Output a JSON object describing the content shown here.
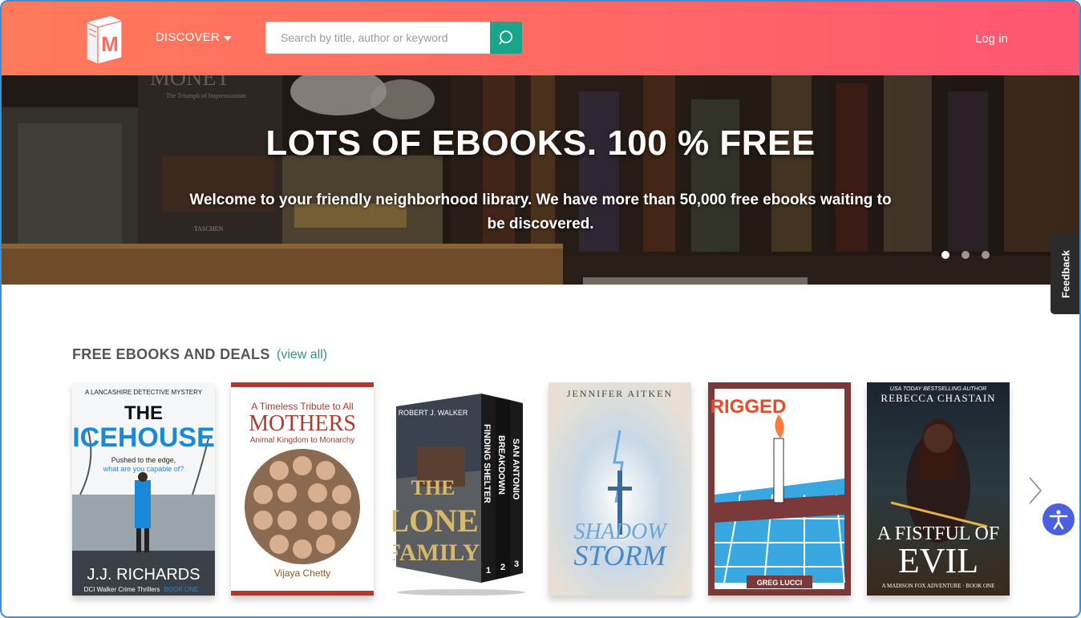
{
  "header": {
    "logo_letter": "M",
    "discover_label": "DISCOVER",
    "search_placeholder": "Search by title, author or keyword",
    "login_label": "Log in"
  },
  "hero": {
    "title": "LOTS OF EBOOKS. 100 % FREE",
    "subtitle": "Welcome to your friendly neighborhood library. We have more than 50,000 free ebooks waiting to be discovered.",
    "slides": 3,
    "active_slide": 1,
    "background_text": {
      "monet": "MONET",
      "monet_sub": "The Triumph of Impressionism",
      "taschen": "TASCHEN"
    }
  },
  "feedback_label": "Feedback",
  "section": {
    "title": "FREE EBOOKS AND DEALS",
    "view_all": "(view all)"
  },
  "books": [
    {
      "series": "A LANCASHIRE DETECTIVE MYSTERY",
      "title_top": "THE",
      "title_main": "ICEHOUSE",
      "tagline1": "Pushed to the edge,",
      "tagline2": "what are you capable of?",
      "author": "J.J. RICHARDS",
      "footer": "DCI Walker Crime Thrillers",
      "footer_accent": "BOOK ONE"
    },
    {
      "line1": "A Timeless Tribute to All",
      "title": "MOTHERS",
      "line2": "Animal Kingdom to Monarchy",
      "author": "Vijaya Chetty"
    },
    {
      "author": "ROBERT J. WALKER",
      "spine1": "FINDING SHELTER",
      "spine2": "BREAKDOWN",
      "spine3": "SAN ANTONIO",
      "num1": "1",
      "num2": "2",
      "num3": "3",
      "title1": "THE",
      "title2": "LONE",
      "title3": "FAMILY"
    },
    {
      "author": "JENNIFER AITKEN",
      "title1": "SHADOW",
      "title2": "STORM"
    },
    {
      "title": "RIGGED",
      "author": "GREG LUCCI"
    },
    {
      "tagline": "USA TODAY BESTSELLING AUTHOR",
      "author": "REBECCA CHASTAIN",
      "title1": "A FISTFUL OF",
      "title2": "EVIL",
      "footer": "A MADISON FOX ADVENTURE · BOOK ONE"
    }
  ],
  "colors": {
    "header_start": "#ff7a5a",
    "header_end": "#ff5672",
    "search_button": "#1aa58b",
    "view_all": "#3a8f89",
    "accessibility": "#4a60e0",
    "frame_border": "#3b8fd6"
  }
}
